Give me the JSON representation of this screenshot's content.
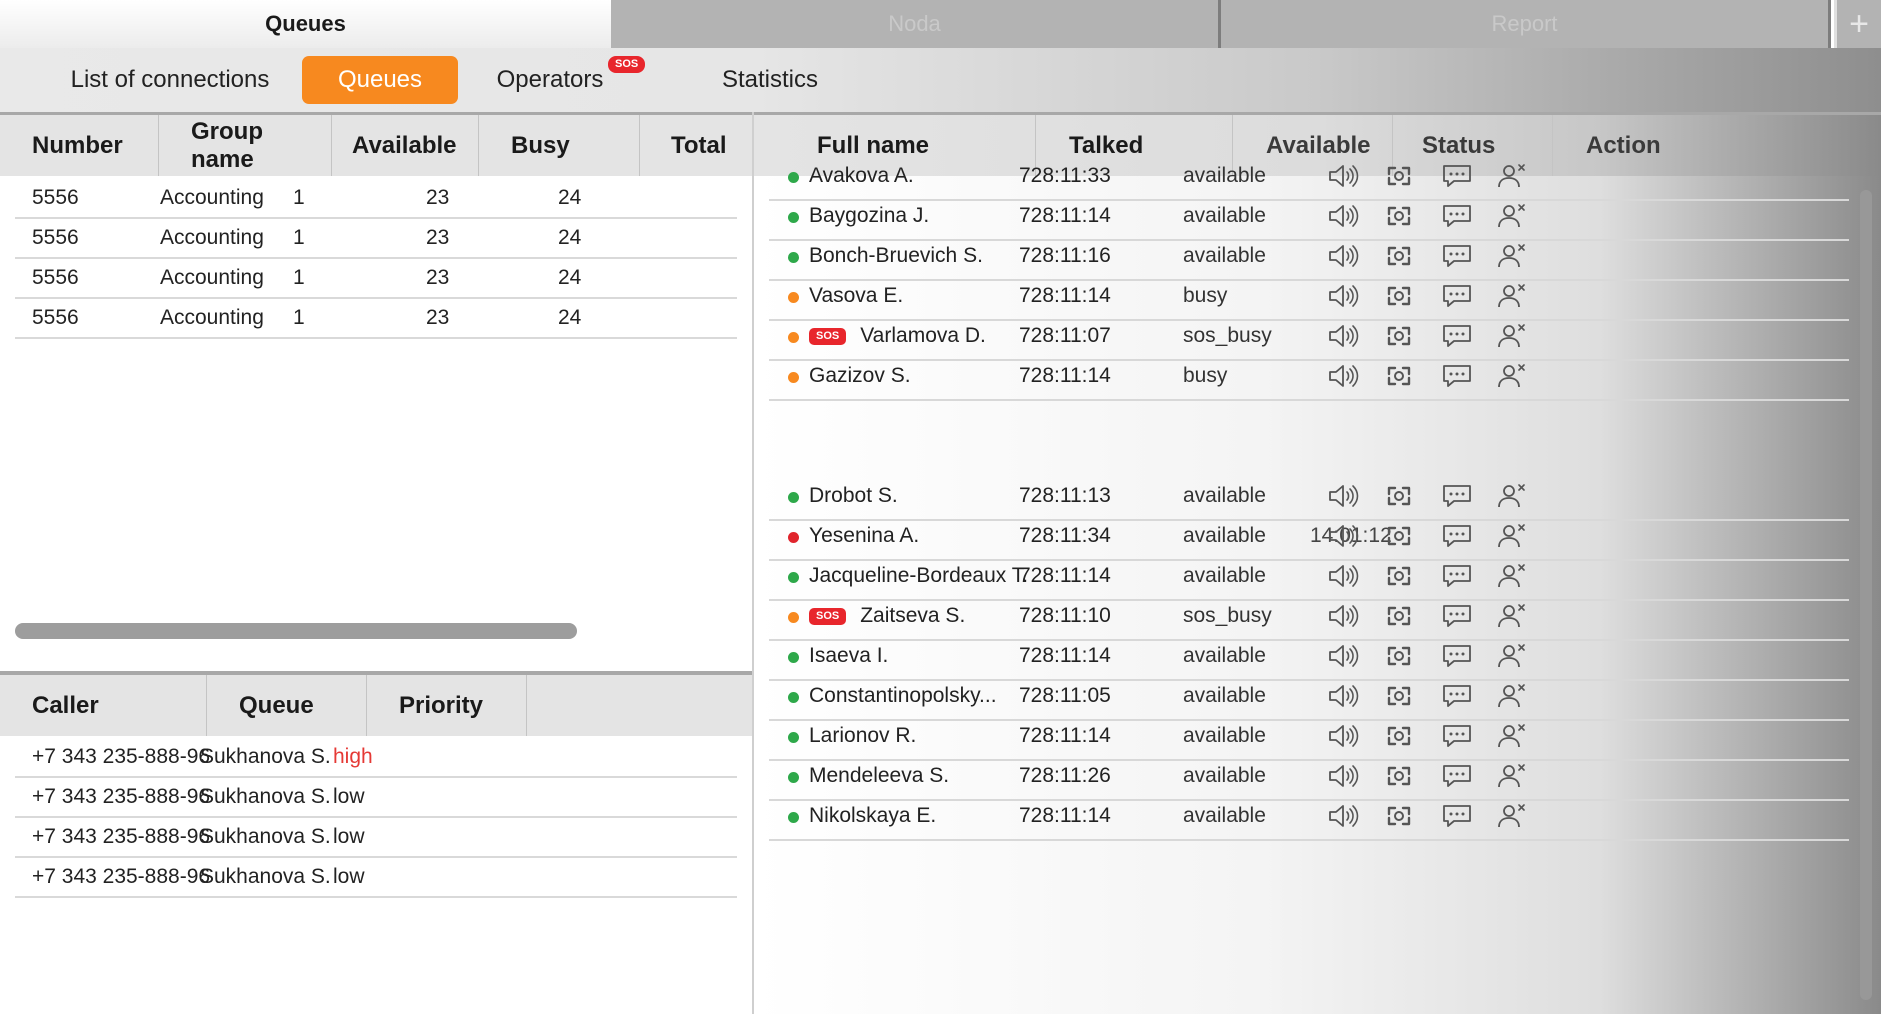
{
  "top_tabs": [
    {
      "label": "Queues",
      "active": true
    },
    {
      "label": "Noda",
      "active": false
    },
    {
      "label": "Report",
      "active": false
    }
  ],
  "top_add_label": "+",
  "subnav": [
    {
      "label": "List of connections",
      "active": false
    },
    {
      "label": "Queues",
      "active": true
    },
    {
      "label": "Operators",
      "active": false,
      "badge": "SOS"
    },
    {
      "label": "Statistics",
      "active": false
    }
  ],
  "queue_table": {
    "headers": [
      "Number",
      "Group name",
      "Available",
      "Busy",
      "Total"
    ],
    "rows": [
      [
        "5556",
        "Accounting",
        "1",
        "23",
        "24"
      ],
      [
        "5556",
        "Accounting",
        "1",
        "23",
        "24"
      ],
      [
        "5556",
        "Accounting",
        "1",
        "23",
        "24"
      ],
      [
        "5556",
        "Accounting",
        "1",
        "23",
        "24"
      ]
    ]
  },
  "callers_table": {
    "headers": [
      "Caller",
      "Queue",
      "Priority"
    ],
    "rows": [
      {
        "caller": "+7 343 235-888-96",
        "queue": "Sukhanova S.",
        "priority": "high",
        "priority_color": "#e53935"
      },
      {
        "caller": "+7 343 235-888-96",
        "queue": "Sukhanova S.",
        "priority": "low",
        "priority_color": "#222222"
      },
      {
        "caller": "+7 343 235-888-96",
        "queue": "Sukhanova S.",
        "priority": "low",
        "priority_color": "#222222"
      },
      {
        "caller": "+7 343 235-888-96",
        "queue": "Sukhanova S.",
        "priority": "low",
        "priority_color": "#222222"
      }
    ]
  },
  "operators_table": {
    "headers": [
      "Full name",
      "Talked",
      "Available",
      "Status",
      "Action"
    ],
    "action_icons": [
      "speaker-icon",
      "screen-capture-icon",
      "chat-icon",
      "remove-user-icon"
    ],
    "status_colors": {
      "green": "#2ea84a",
      "orange": "#f7891f",
      "red": "#e0242c"
    },
    "group1": [
      {
        "dot": "green",
        "sos": false,
        "name": "Avakova A.",
        "talked": "728:11:33",
        "available": "available",
        "status": ""
      },
      {
        "dot": "green",
        "sos": false,
        "name": "Baygozina J.",
        "talked": "728:11:14",
        "available": "available",
        "status": ""
      },
      {
        "dot": "green",
        "sos": false,
        "name": "Bonch-Bruevich S.",
        "talked": "728:11:16",
        "available": "available",
        "status": ""
      },
      {
        "dot": "orange",
        "sos": false,
        "name": "Vasova E.",
        "talked": "728:11:14",
        "available": "busy",
        "status": ""
      },
      {
        "dot": "orange",
        "sos": true,
        "name": "Varlamova D.",
        "talked": "728:11:07",
        "available": "sos_busy",
        "status": ""
      },
      {
        "dot": "orange",
        "sos": false,
        "name": "Gazizov S.",
        "talked": "728:11:14",
        "available": "busy",
        "status": ""
      }
    ],
    "group2": [
      {
        "dot": "green",
        "sos": false,
        "name": "Drobot S.",
        "talked": "728:11:13",
        "available": "available",
        "status": ""
      },
      {
        "dot": "red",
        "sos": false,
        "name": "Yesenina A.",
        "talked": "728:11:34",
        "available": "available",
        "status": "14:01:12"
      },
      {
        "dot": "green",
        "sos": false,
        "name": "Jacqueline-Bordeaux T.",
        "talked": "728:11:14",
        "available": "available",
        "status": ""
      },
      {
        "dot": "orange",
        "sos": true,
        "name": "Zaitseva S.",
        "talked": "728:11:10",
        "available": "sos_busy",
        "status": ""
      },
      {
        "dot": "green",
        "sos": false,
        "name": "Isaeva I.",
        "talked": "728:11:14",
        "available": "available",
        "status": ""
      },
      {
        "dot": "green",
        "sos": false,
        "name": "Constantinopolsky...",
        "talked": "728:11:05",
        "available": "available",
        "status": ""
      },
      {
        "dot": "green",
        "sos": false,
        "name": "Larionov R.",
        "talked": "728:11:14",
        "available": "available",
        "status": ""
      },
      {
        "dot": "green",
        "sos": false,
        "name": "Mendeleeva S.",
        "talked": "728:11:26",
        "available": "available",
        "status": ""
      },
      {
        "dot": "green",
        "sos": false,
        "name": "Nikolskaya E.",
        "talked": "728:11:14",
        "available": "available",
        "status": ""
      }
    ]
  },
  "sos_label": "SOS"
}
